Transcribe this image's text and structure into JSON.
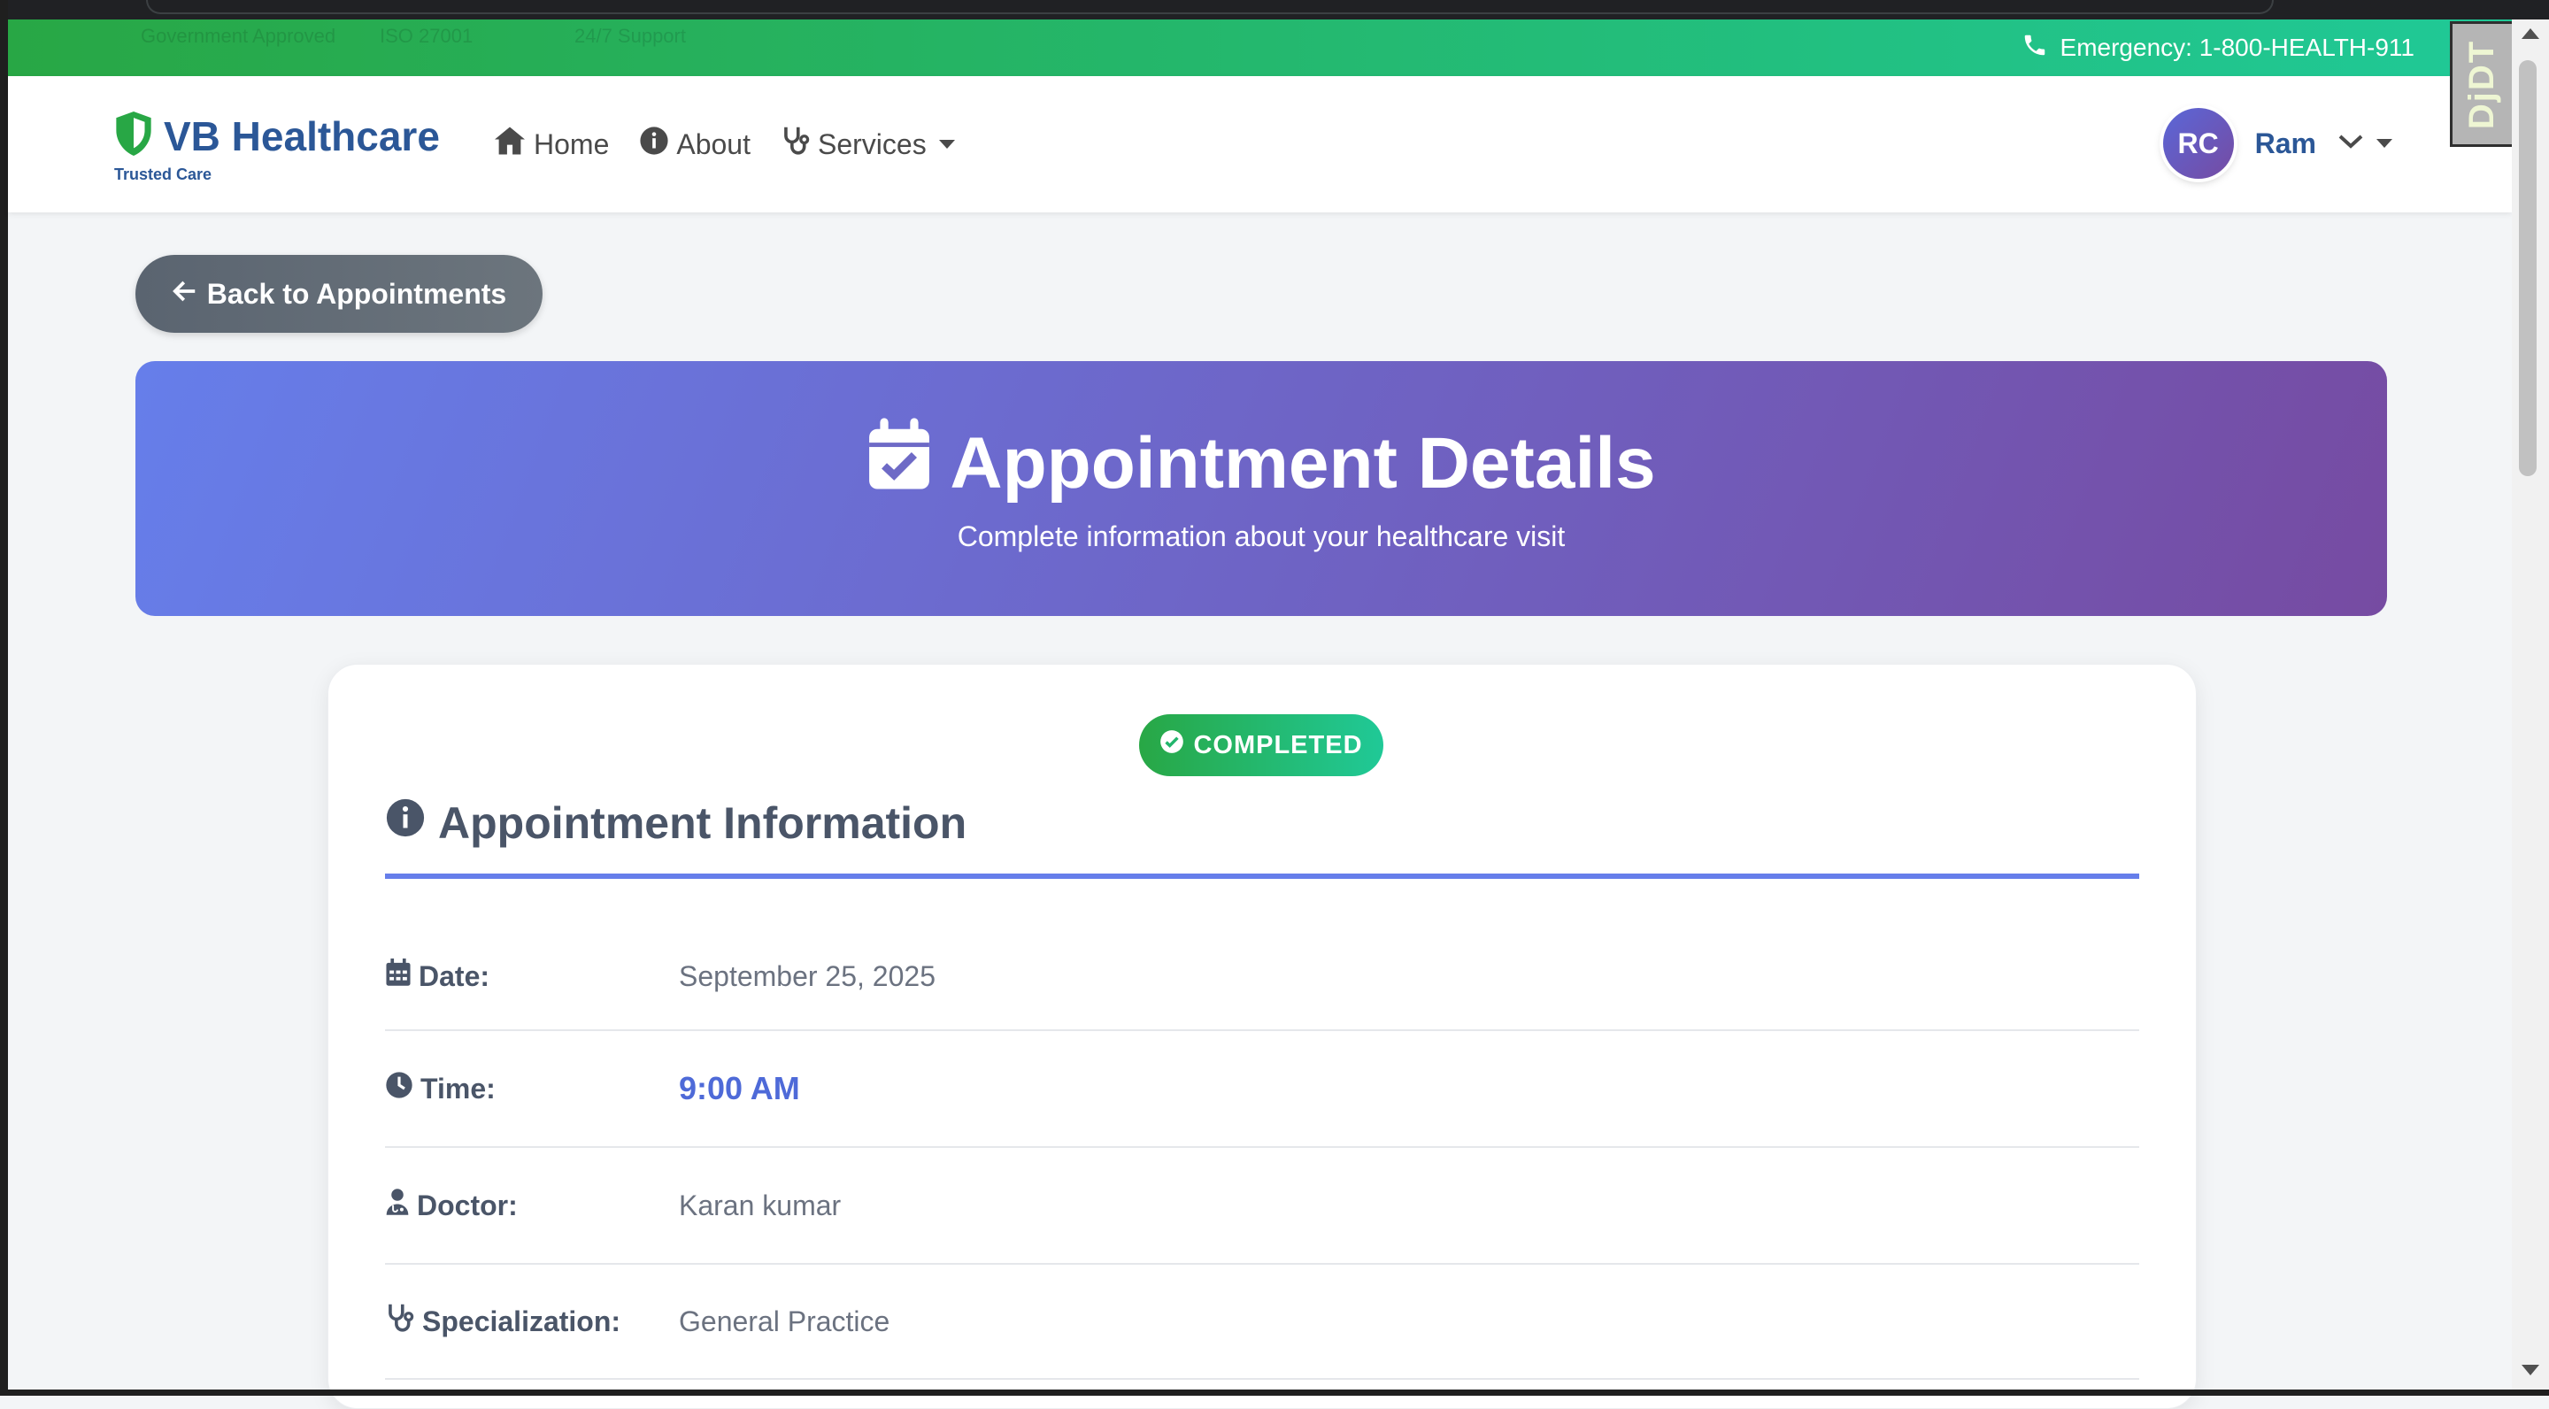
{
  "topbar": {
    "faint_items": [
      "Government Approved",
      "ISO 27001",
      "24/7 Support"
    ],
    "emergency": "Emergency: 1-800-HEALTH-911",
    "phone_icon": "phone-icon"
  },
  "navbar": {
    "brand_name": "VB Healthcare",
    "brand_tagline": "Trusted Care",
    "links": [
      {
        "label": "Home",
        "icon": "home-icon"
      },
      {
        "label": "About",
        "icon": "info-icon"
      },
      {
        "label": "Services",
        "icon": "stethoscope-icon"
      }
    ],
    "user": {
      "initials": "RC",
      "name": "Ram"
    }
  },
  "debug_toolbar": {
    "label": "DjDT"
  },
  "back_button": {
    "label": "Back to Appointments"
  },
  "hero": {
    "title": "Appointment Details",
    "subtitle": "Complete information about your healthcare visit"
  },
  "card": {
    "status": "COMPLETED",
    "section_title": "Appointment Information",
    "rows": [
      {
        "label": "Date:",
        "value": "September 25, 2025",
        "icon": "calendar-icon"
      },
      {
        "label": "Time:",
        "value": "9:00 AM",
        "icon": "clock-icon"
      },
      {
        "label": "Doctor:",
        "value": "Karan kumar",
        "icon": "doctor-icon"
      },
      {
        "label": "Specialization:",
        "value": "General Practice",
        "icon": "stethoscope-icon"
      }
    ]
  },
  "colors": {
    "topbar_start": "#28a745",
    "topbar_end": "#20c997",
    "brand": "#2b5797",
    "hero_start": "#667eea",
    "hero_end": "#764ba2",
    "accent": "#4e6ad8"
  }
}
